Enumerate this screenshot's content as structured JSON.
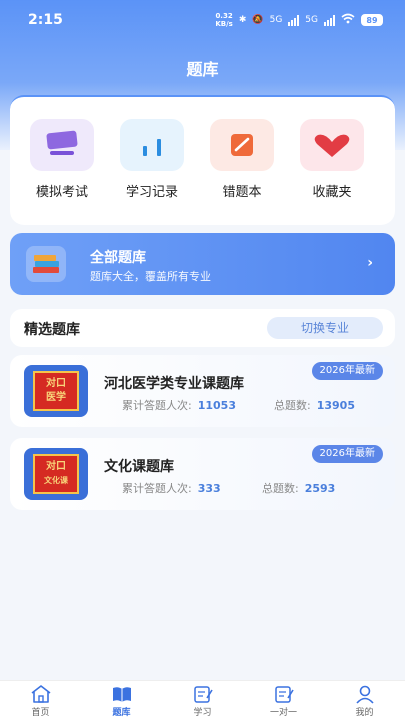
{
  "status": {
    "time": "2:15",
    "net_speed_value": "0.32",
    "net_speed_unit": "KB/s",
    "net1": "5G",
    "net2": "5G",
    "battery": "89"
  },
  "header": {
    "title": "题库"
  },
  "quick": [
    {
      "label": "模拟考试",
      "icon": "exam-icon",
      "bg": "#efe9fb"
    },
    {
      "label": "学习记录",
      "icon": "chart-icon",
      "bg": "#e6f3fd"
    },
    {
      "label": "错题本",
      "icon": "wrong-book-icon",
      "bg": "#fde9e4"
    },
    {
      "label": "收藏夹",
      "icon": "heart-icon",
      "bg": "#fde6ea"
    }
  ],
  "all_bank": {
    "title": "全部题库",
    "subtitle": "题库大全，覆盖所有专业",
    "arrow": "›"
  },
  "selected": {
    "title": "精选题库",
    "switch_label": "切换专业"
  },
  "courses": [
    {
      "name": "河北医学类专业课题库",
      "badge": "2026年最新",
      "seal_top": "对口",
      "seal_bottom": "医学",
      "stat_label": "累计答题人次:",
      "stat_value": "11053",
      "total_label": "总题数:",
      "total_value": "13905"
    },
    {
      "name": "文化课题库",
      "badge": "2026年最新",
      "seal_top": "对口",
      "seal_bottom": "文化课",
      "stat_label": "累计答题人次:",
      "stat_value": "333",
      "total_label": "总题数:",
      "total_value": "2593"
    }
  ],
  "tabs": [
    {
      "label": "首页",
      "icon": "home-icon",
      "active": false
    },
    {
      "label": "题库",
      "icon": "book-icon",
      "active": true
    },
    {
      "label": "学习",
      "icon": "study-icon",
      "active": false
    },
    {
      "label": "一对一",
      "icon": "tutor-icon",
      "active": false
    },
    {
      "label": "我的",
      "icon": "profile-icon",
      "active": false
    }
  ],
  "colors": {
    "primary": "#5b93f7",
    "accent_text": "#4a7fdc",
    "badge": "#5b86e8",
    "seal_red": "#d52a22"
  }
}
